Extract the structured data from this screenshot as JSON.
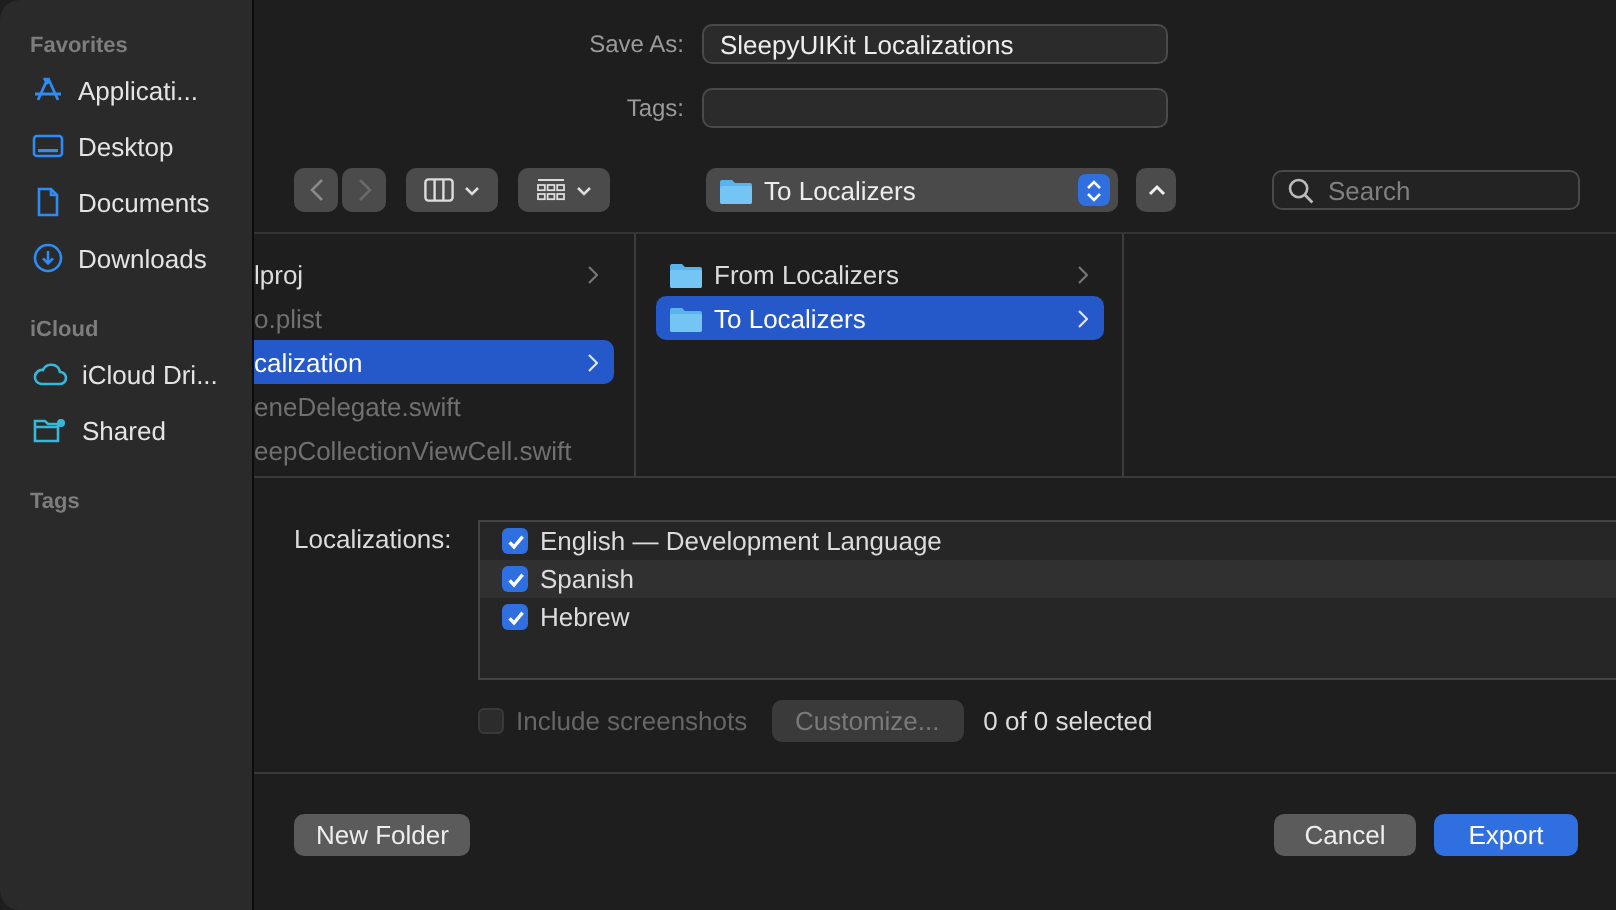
{
  "sidebar": {
    "sections": [
      {
        "title": "Favorites",
        "items": [
          {
            "label": "Applicati...",
            "kind": "apps"
          },
          {
            "label": "Desktop",
            "kind": "desktop"
          },
          {
            "label": "Documents",
            "kind": "document"
          },
          {
            "label": "Downloads",
            "kind": "download"
          }
        ]
      },
      {
        "title": "iCloud",
        "items": [
          {
            "label": "iCloud Dri...",
            "kind": "cloud"
          },
          {
            "label": "Shared",
            "kind": "shared"
          }
        ]
      },
      {
        "title": "Tags"
      }
    ]
  },
  "save_as": {
    "label": "Save As:",
    "value": "SleepyUIKit Localizations"
  },
  "tags": {
    "label": "Tags:"
  },
  "location": {
    "label": "To Localizers"
  },
  "search": {
    "placeholder": "Search"
  },
  "browser": {
    "columns": [
      {
        "items": [
          {
            "label": "lproj",
            "disabled": false,
            "selected": false,
            "kind": "folder"
          },
          {
            "label": "o.plist",
            "disabled": true,
            "selected": false,
            "kind": "file"
          },
          {
            "label": "calization",
            "disabled": false,
            "selected": true,
            "kind": "folder"
          },
          {
            "label": "eneDelegate.swift",
            "disabled": true,
            "selected": false,
            "kind": "file"
          },
          {
            "label": "eepCollectionViewCell.swift",
            "disabled": true,
            "selected": false,
            "kind": "file"
          }
        ]
      },
      {
        "items": [
          {
            "label": "From Localizers",
            "disabled": false,
            "selected": false,
            "kind": "folder"
          },
          {
            "label": "To Localizers",
            "disabled": false,
            "selected": true,
            "kind": "folder"
          }
        ]
      },
      {}
    ]
  },
  "localizations": {
    "label": "Localizations:",
    "items": [
      {
        "label": "English — Development Language",
        "checked": true
      },
      {
        "label": "Spanish",
        "checked": true
      },
      {
        "label": "Hebrew",
        "checked": true
      }
    ]
  },
  "include_screenshots": {
    "label": "Include screenshots",
    "checked": false,
    "disabled": true
  },
  "customize_button": {
    "label": "Customize...",
    "disabled": true
  },
  "selection_count": "0 of 0 selected",
  "buttons": {
    "new_folder": "New Folder",
    "cancel": "Cancel",
    "export": "Export"
  }
}
